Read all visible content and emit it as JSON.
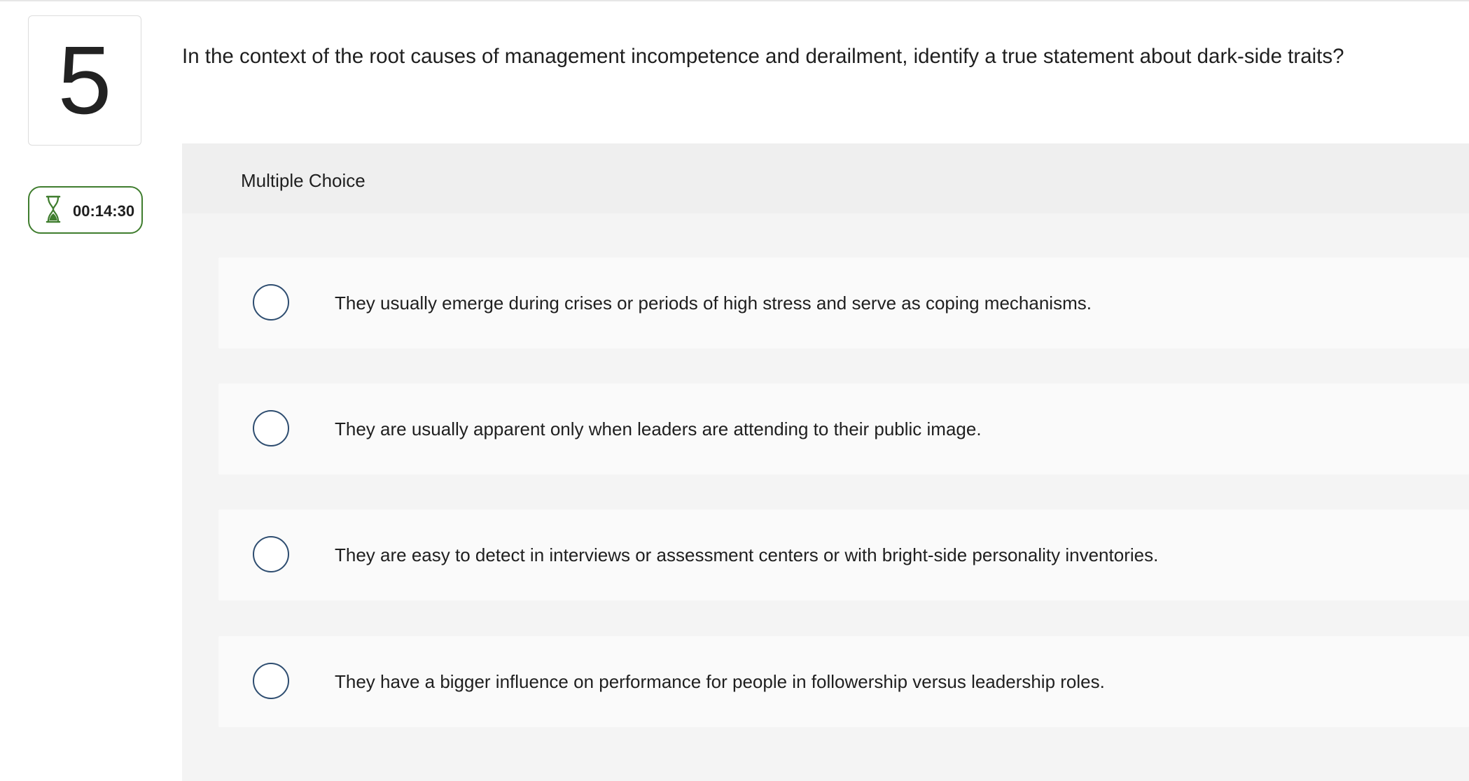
{
  "question": {
    "number": "5",
    "text": "In the context of the root causes of management incompetence and derailment, identify a true statement about dark-side traits?",
    "type_label": "Multiple Choice"
  },
  "timer": {
    "icon": "hourglass-icon",
    "value": "00:14:30",
    "accent_color": "#3f7d2e"
  },
  "options": [
    {
      "text": "They usually emerge during crises or periods of high stress and serve as coping mechanisms.",
      "selected": false
    },
    {
      "text": "They are usually apparent only when leaders are attending to their public image.",
      "selected": false
    },
    {
      "text": "They are easy to detect in interviews or assessment centers or with bright-side personality inventories.",
      "selected": false
    },
    {
      "text": "They have a bigger influence on performance for people in followership versus leadership roles.",
      "selected": false
    }
  ],
  "colors": {
    "radio_border": "#2e4d70",
    "panel_background": "#f4f4f4",
    "option_background": "#fafafa"
  }
}
